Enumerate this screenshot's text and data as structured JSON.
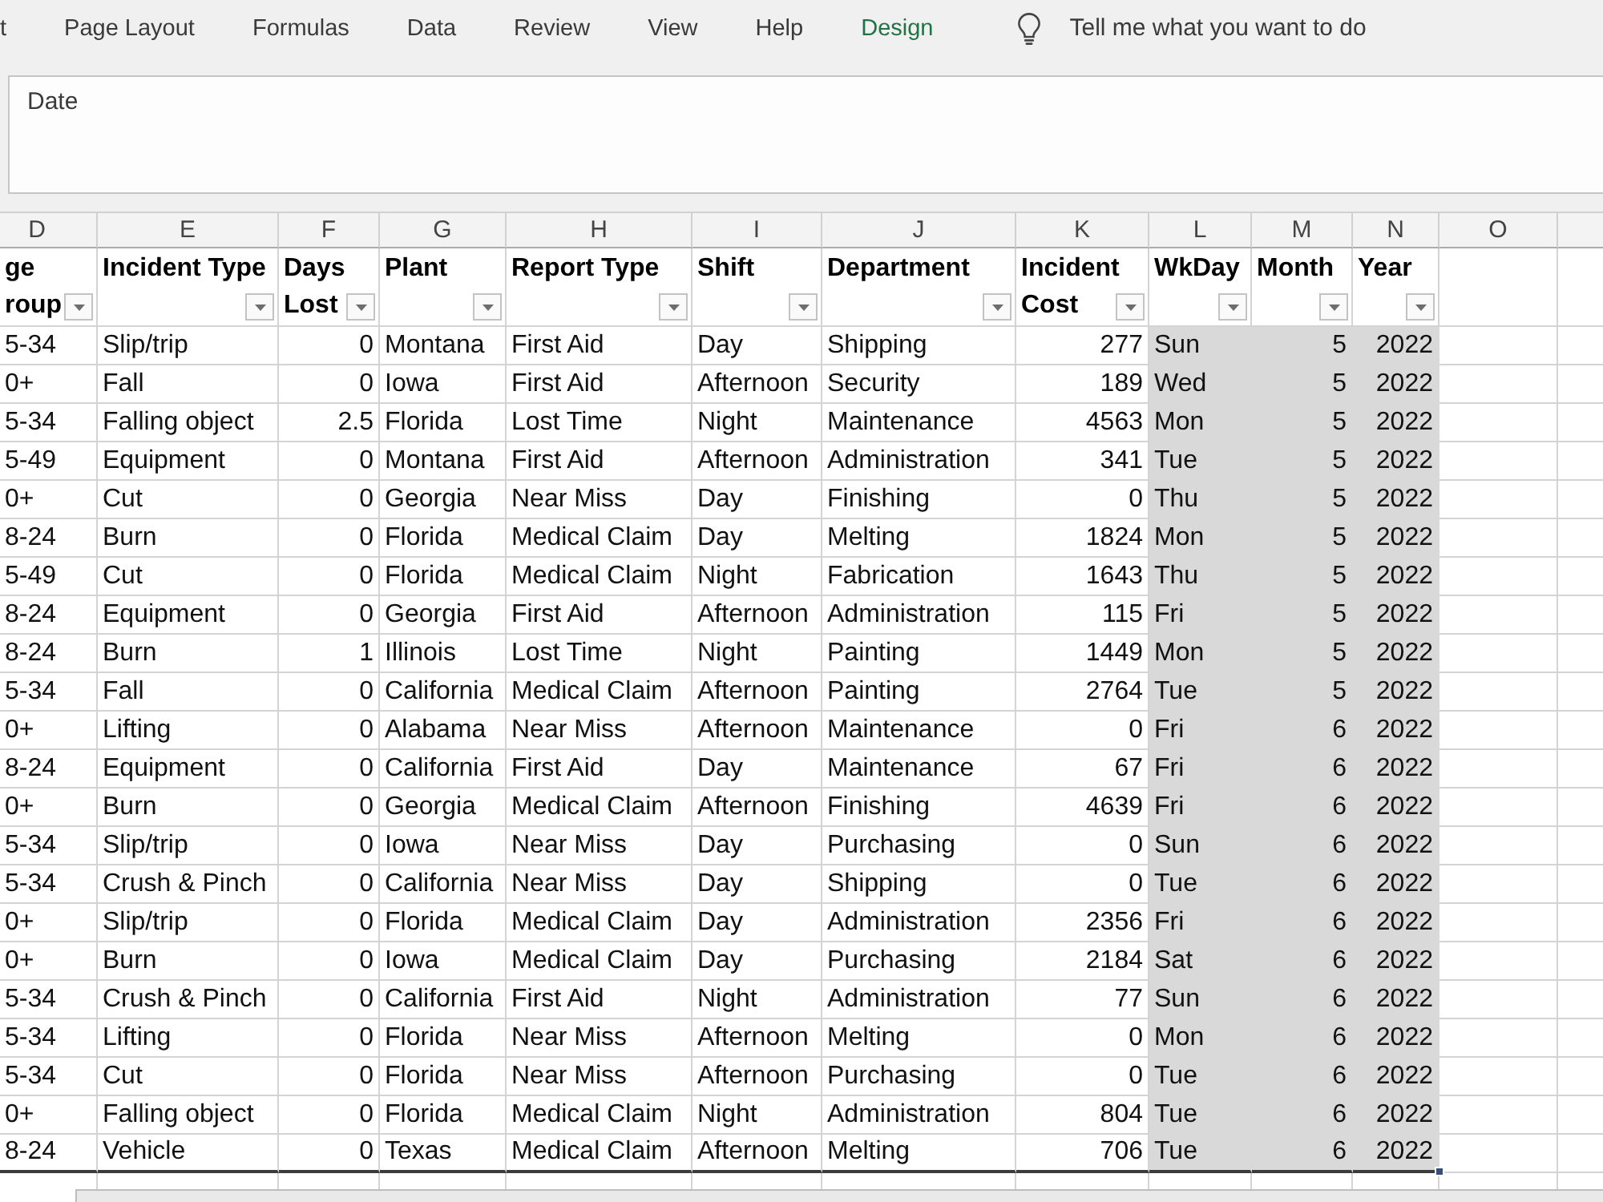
{
  "ribbon": {
    "tabs": [
      {
        "label": "t",
        "kind": "standard"
      },
      {
        "label": "Page Layout",
        "kind": "standard"
      },
      {
        "label": "Formulas",
        "kind": "standard"
      },
      {
        "label": "Data",
        "kind": "standard"
      },
      {
        "label": "Review",
        "kind": "standard"
      },
      {
        "label": "View",
        "kind": "standard"
      },
      {
        "label": "Help",
        "kind": "standard"
      },
      {
        "label": "Design",
        "kind": "contextual"
      }
    ],
    "tell_me": {
      "placeholder": "Tell me what you want to do"
    }
  },
  "formula_bar": {
    "value": "Date"
  },
  "column_headers": [
    "D",
    "E",
    "F",
    "G",
    "H",
    "I",
    "J",
    "K",
    "L",
    "M",
    "N",
    "O"
  ],
  "table": {
    "columns": [
      {
        "heading": "ge roup",
        "kind": "text",
        "selected": false
      },
      {
        "heading": "Incident Type",
        "kind": "text",
        "selected": false
      },
      {
        "heading": "Days Lost",
        "kind": "number",
        "selected": false
      },
      {
        "heading": "Plant",
        "kind": "text",
        "selected": false
      },
      {
        "heading": "Report Type",
        "kind": "text",
        "selected": false
      },
      {
        "heading": "Shift",
        "kind": "text",
        "selected": false
      },
      {
        "heading": "Department",
        "kind": "text",
        "selected": false
      },
      {
        "heading": "Incident Cost",
        "kind": "number",
        "selected": false
      },
      {
        "heading": "WkDay",
        "kind": "text",
        "selected": true
      },
      {
        "heading": "Month",
        "kind": "number",
        "selected": true
      },
      {
        "heading": "Year",
        "kind": "number",
        "selected": true
      }
    ],
    "rows": [
      [
        "5-34",
        "Slip/trip",
        "0",
        "Montana",
        "First Aid",
        "Day",
        "Shipping",
        "277",
        "Sun",
        "5",
        "2022"
      ],
      [
        "0+",
        "Fall",
        "0",
        "Iowa",
        "First Aid",
        "Afternoon",
        "Security",
        "189",
        "Wed",
        "5",
        "2022"
      ],
      [
        "5-34",
        "Falling object",
        "2.5",
        "Florida",
        "Lost Time",
        "Night",
        "Maintenance",
        "4563",
        "Mon",
        "5",
        "2022"
      ],
      [
        "5-49",
        "Equipment",
        "0",
        "Montana",
        "First Aid",
        "Afternoon",
        "Administration",
        "341",
        "Tue",
        "5",
        "2022"
      ],
      [
        "0+",
        "Cut",
        "0",
        "Georgia",
        "Near Miss",
        "Day",
        "Finishing",
        "0",
        "Thu",
        "5",
        "2022"
      ],
      [
        "8-24",
        "Burn",
        "0",
        "Florida",
        "Medical Claim",
        "Day",
        "Melting",
        "1824",
        "Mon",
        "5",
        "2022"
      ],
      [
        "5-49",
        "Cut",
        "0",
        "Florida",
        "Medical Claim",
        "Night",
        "Fabrication",
        "1643",
        "Thu",
        "5",
        "2022"
      ],
      [
        "8-24",
        "Equipment",
        "0",
        "Georgia",
        "First Aid",
        "Afternoon",
        "Administration",
        "115",
        "Fri",
        "5",
        "2022"
      ],
      [
        "8-24",
        "Burn",
        "1",
        "Illinois",
        "Lost Time",
        "Night",
        "Painting",
        "1449",
        "Mon",
        "5",
        "2022"
      ],
      [
        "5-34",
        "Fall",
        "0",
        "California",
        "Medical Claim",
        "Afternoon",
        "Painting",
        "2764",
        "Tue",
        "5",
        "2022"
      ],
      [
        "0+",
        "Lifting",
        "0",
        "Alabama",
        "Near Miss",
        "Afternoon",
        "Maintenance",
        "0",
        "Fri",
        "6",
        "2022"
      ],
      [
        "8-24",
        "Equipment",
        "0",
        "California",
        "First Aid",
        "Day",
        "Maintenance",
        "67",
        "Fri",
        "6",
        "2022"
      ],
      [
        "0+",
        "Burn",
        "0",
        "Georgia",
        "Medical Claim",
        "Afternoon",
        "Finishing",
        "4639",
        "Fri",
        "6",
        "2022"
      ],
      [
        "5-34",
        "Slip/trip",
        "0",
        "Iowa",
        "Near Miss",
        "Day",
        "Purchasing",
        "0",
        "Sun",
        "6",
        "2022"
      ],
      [
        "5-34",
        "Crush & Pinch",
        "0",
        "California",
        "Near Miss",
        "Day",
        "Shipping",
        "0",
        "Tue",
        "6",
        "2022"
      ],
      [
        "0+",
        "Slip/trip",
        "0",
        "Florida",
        "Medical Claim",
        "Day",
        "Administration",
        "2356",
        "Fri",
        "6",
        "2022"
      ],
      [
        "0+",
        "Burn",
        "0",
        "Iowa",
        "Medical Claim",
        "Day",
        "Purchasing",
        "2184",
        "Sat",
        "6",
        "2022"
      ],
      [
        "5-34",
        "Crush & Pinch",
        "0",
        "California",
        "First Aid",
        "Night",
        "Administration",
        "77",
        "Sun",
        "6",
        "2022"
      ],
      [
        "5-34",
        "Lifting",
        "0",
        "Florida",
        "Near Miss",
        "Afternoon",
        "Melting",
        "0",
        "Mon",
        "6",
        "2022"
      ],
      [
        "5-34",
        "Cut",
        "0",
        "Florida",
        "Near Miss",
        "Afternoon",
        "Purchasing",
        "0",
        "Tue",
        "6",
        "2022"
      ],
      [
        "0+",
        "Falling object",
        "0",
        "Florida",
        "Medical Claim",
        "Night",
        "Administration",
        "804",
        "Tue",
        "6",
        "2022"
      ],
      [
        "8-24",
        "Vehicle",
        "0",
        "Texas",
        "Medical Claim",
        "Afternoon",
        "Melting",
        "706",
        "Tue",
        "6",
        "2022"
      ]
    ]
  }
}
